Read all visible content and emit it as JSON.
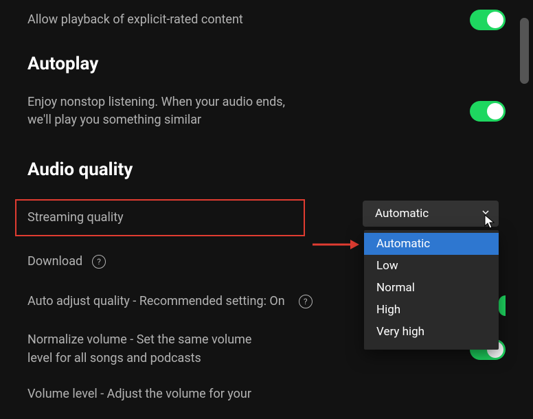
{
  "explicit": {
    "label": "Allow playback of explicit-rated content",
    "enabled": true
  },
  "autoplay": {
    "heading": "Autoplay",
    "description": "Enjoy nonstop listening. When your audio ends, we'll play you something similar",
    "enabled": true
  },
  "audio_quality": {
    "heading": "Audio quality",
    "streaming_label": "Streaming quality",
    "streaming_value": "Automatic",
    "options": [
      "Automatic",
      "Low",
      "Normal",
      "High",
      "Very high"
    ],
    "download_label": "Download",
    "auto_adjust_label": "Auto adjust quality - Recommended setting: On",
    "normalize_label": "Normalize volume - Set the same volume level for all songs and podcasts",
    "normalize_enabled": true,
    "volume_level_label": "Volume level - Adjust the volume for your"
  }
}
